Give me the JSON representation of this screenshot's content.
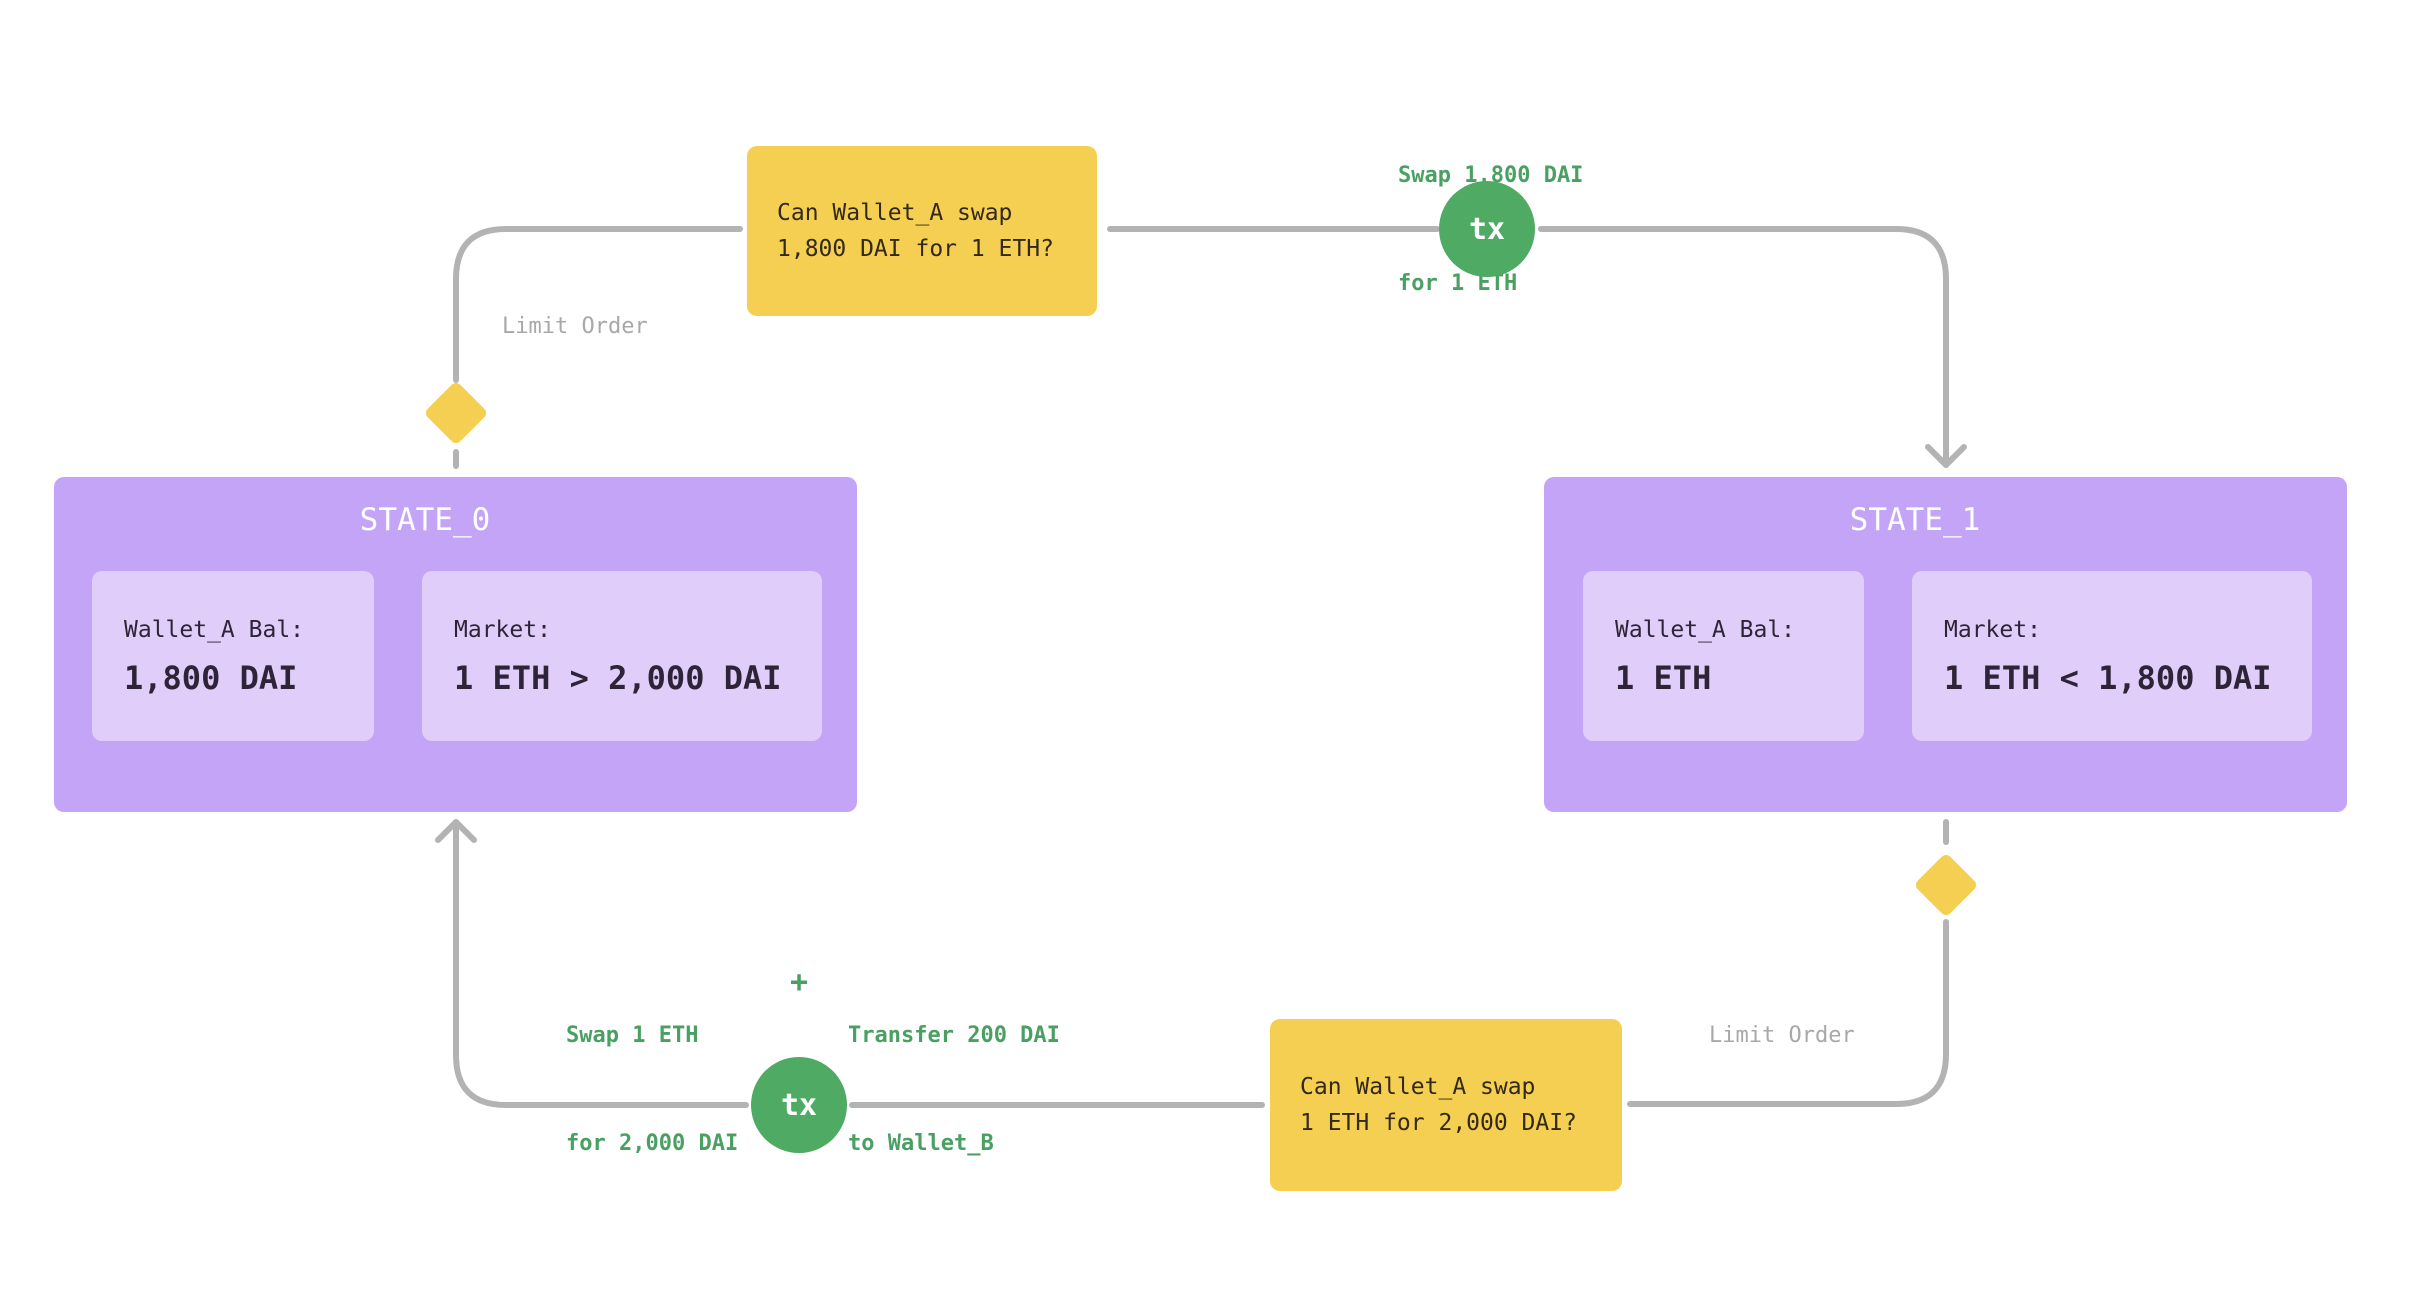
{
  "colors": {
    "state_bg": "#c4a4f6",
    "inner_bg": "#e0cdfa",
    "decision_bg": "#f5cf51",
    "tx_bg": "#4faa64",
    "tx_label": "#4a9f63",
    "connector": "#b3b3b3",
    "muted_text": "#a8a8a8"
  },
  "states": [
    {
      "title": "STATE_0",
      "wallet_label": "Wallet_A Bal:",
      "wallet_value": "1,800 DAI",
      "market_label": "Market:",
      "market_value": "1 ETH > 2,000 DAI"
    },
    {
      "title": "STATE_1",
      "wallet_label": "Wallet_A Bal:",
      "wallet_value": "1 ETH",
      "market_label": "Market:",
      "market_value": "1 ETH < 1,800 DAI"
    }
  ],
  "decisions": [
    {
      "line1": "Can Wallet_A swap",
      "line2": "1,800 DAI for 1 ETH?"
    },
    {
      "line1": "Can Wallet_A swap",
      "line2": "1 ETH for 2,000 DAI?"
    }
  ],
  "edge_labels": {
    "top_limit_order": "Limit Order",
    "bottom_limit_order": "Limit Order"
  },
  "transactions": [
    {
      "label": "tx",
      "actions": [
        {
          "line1": "Swap 1,800 DAI",
          "line2": "for 1 ETH"
        }
      ]
    },
    {
      "label": "tx",
      "actions": [
        {
          "line1": "Swap 1 ETH",
          "line2": "for 2,000 DAI"
        },
        {
          "line1": "Transfer 200 DAI",
          "line2": "to Wallet_B"
        }
      ],
      "joiner": "+"
    }
  ]
}
